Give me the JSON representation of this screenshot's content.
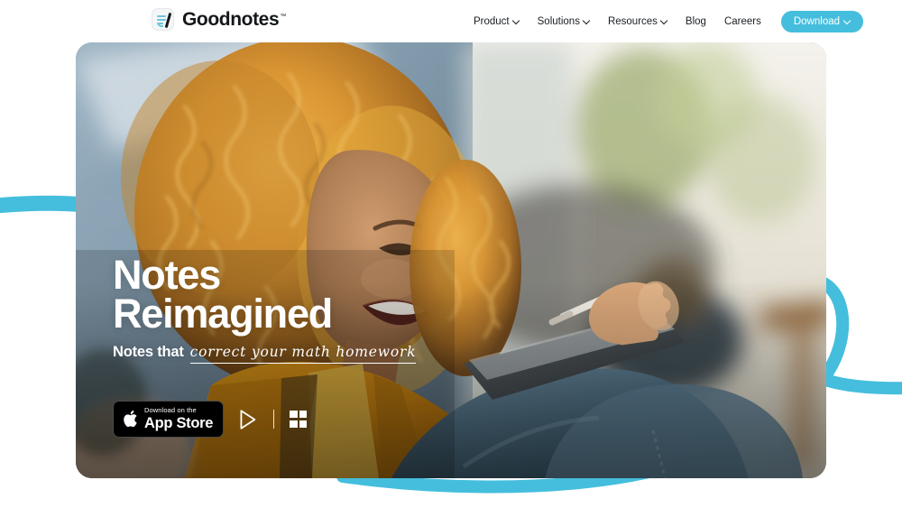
{
  "brand": {
    "name": "Goodnotes",
    "trademark": "™",
    "logo_icon": "goodnotes-notebook-pen-icon"
  },
  "nav": {
    "items": [
      {
        "label": "Product",
        "has_dropdown": true,
        "icon": "chevron-down-icon"
      },
      {
        "label": "Solutions",
        "has_dropdown": true,
        "icon": "chevron-down-icon"
      },
      {
        "label": "Resources",
        "has_dropdown": true,
        "icon": "chevron-down-icon"
      },
      {
        "label": "Blog",
        "has_dropdown": false,
        "icon": ""
      },
      {
        "label": "Careers",
        "has_dropdown": false,
        "icon": ""
      }
    ],
    "download_button": {
      "label": "Download",
      "icon": "chevron-down-icon",
      "background": "#45bedd",
      "text_color": "#ffffff"
    }
  },
  "hero": {
    "headline_line1": "Notes",
    "headline_line2": "Reimagined",
    "subtitle_static": "Notes that",
    "subtitle_handwritten": "correct your math homework",
    "text_color": "#ffffff",
    "image_alt": "Smiling woman with curly golden hair in a mustard jacket writing on a tablet with a stylus",
    "stores": {
      "app_store": {
        "icon": "apple-logo-icon",
        "eyebrow": "Download on the",
        "name": "App Store"
      },
      "google_play": {
        "icon": "google-play-icon",
        "label": "Google Play"
      },
      "windows": {
        "icon": "windows-logo-icon",
        "label": "Windows"
      }
    }
  },
  "decor": {
    "swoosh_icon": "cyan-ribbon-swoosh",
    "swoosh_color": "#45bedd"
  }
}
